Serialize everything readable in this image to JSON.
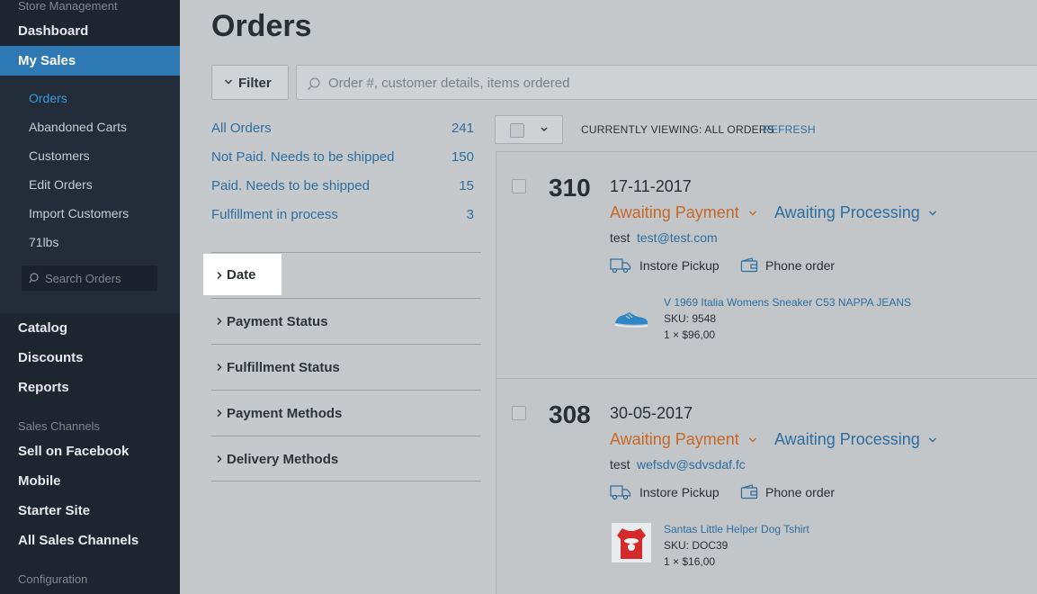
{
  "sidebar": {
    "section_store": "Store Management",
    "dashboard": "Dashboard",
    "my_sales": "My Sales",
    "sub_items": [
      {
        "label": "Orders"
      },
      {
        "label": "Abandoned Carts"
      },
      {
        "label": "Customers"
      },
      {
        "label": "Edit Orders"
      },
      {
        "label": "Import Customers"
      },
      {
        "label": "71lbs"
      }
    ],
    "search_placeholder": "Search Orders",
    "catalog": "Catalog",
    "discounts": "Discounts",
    "reports": "Reports",
    "section_channels": "Sales Channels",
    "sell_on_facebook": "Sell on Facebook",
    "mobile": "Mobile",
    "starter_site": "Starter Site",
    "all_sales_channels": "All Sales Channels",
    "section_config": "Configuration"
  },
  "main": {
    "title": "Orders",
    "filter_label": "Filter",
    "search_placeholder": "Order #, customer details, items ordered",
    "status_filters": [
      {
        "name": "All Orders",
        "count": "241"
      },
      {
        "name": "Not Paid. Needs to be shipped",
        "count": "150"
      },
      {
        "name": "Paid. Needs to be shipped",
        "count": "15"
      },
      {
        "name": "Fulfillment in process",
        "count": "3"
      }
    ],
    "facets": {
      "date": "Date",
      "payment_status": "Payment Status",
      "fulfillment_status": "Fulfillment Status",
      "payment_methods": "Payment Methods",
      "delivery_methods": "Delivery Methods"
    },
    "viewing_text": "CURRENTLY VIEWING: ALL ORDERS",
    "refresh_label": "REFRESH"
  },
  "orders": [
    {
      "number": "310",
      "date": "17-11-2017",
      "payment_status": "Awaiting Payment",
      "fulfillment_status": "Awaiting Processing",
      "customer_name": "test",
      "customer_email": "test@test.com",
      "shipping": "Instore Pickup",
      "source": "Phone order",
      "item_name": "V 1969 Italia Womens Sneaker C53 NAPPA JEANS",
      "sku": "SKU: 9548",
      "qty": "1 × $96,00"
    },
    {
      "number": "308",
      "date": "30-05-2017",
      "payment_status": "Awaiting Payment",
      "fulfillment_status": "Awaiting Processing",
      "customer_name": "test",
      "customer_email": "wefsdv@sdvsdaf.fc",
      "shipping": "Instore Pickup",
      "source": "Phone order",
      "item_name": "Santas Little Helper Dog Tshirt",
      "sku": "SKU: DOC39",
      "qty": "1 × $16,00"
    }
  ],
  "colors": {
    "sidebar_bg": "#1c2530",
    "accent_blue": "#2e79b3",
    "link_blue": "#2c6e9e",
    "payment_orange": "#c4682a"
  }
}
